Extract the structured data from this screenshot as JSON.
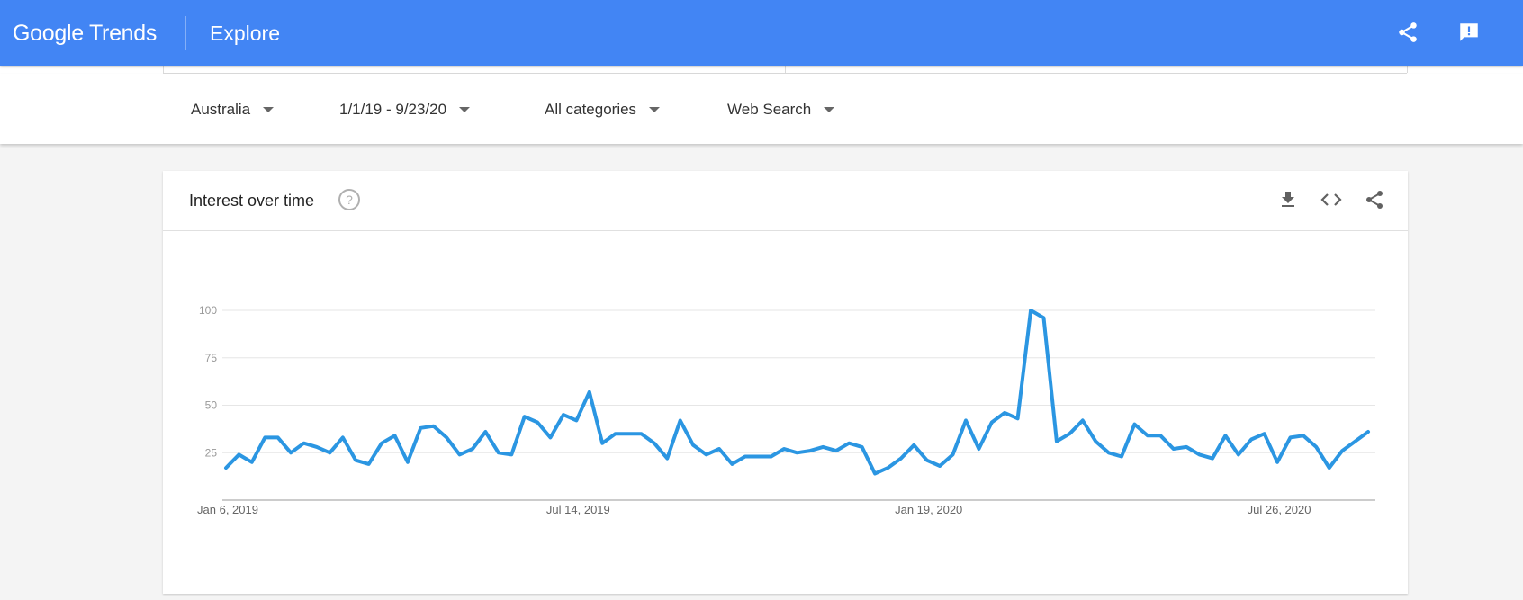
{
  "header": {
    "logo_text": "Google Trends",
    "page_title": "Explore",
    "share_icon": "share-icon",
    "feedback_icon": "feedback-icon"
  },
  "filters": {
    "region": "Australia",
    "date_range": "1/1/19 - 9/23/20",
    "category": "All categories",
    "search_type": "Web Search"
  },
  "card": {
    "title": "Interest over time",
    "help_icon": "help-icon",
    "actions": [
      "download-icon",
      "embed-icon",
      "share-icon"
    ]
  },
  "colors": {
    "appbar": "#4285f4",
    "series": "#2b96e2",
    "grid": "#e6e6e6",
    "axis": "#999999"
  },
  "chart_data": {
    "type": "line",
    "title": "",
    "xlabel": "",
    "ylabel": "",
    "ylim": [
      0,
      100
    ],
    "y_ticks": [
      25,
      50,
      75,
      100
    ],
    "x_tick_labels": [
      {
        "label": "Jan 6, 2019",
        "index": 0
      },
      {
        "label": "Jul 14, 2019",
        "index": 27
      },
      {
        "label": "Jan 19, 2020",
        "index": 54
      },
      {
        "label": "Jul 26, 2020",
        "index": 81
      }
    ],
    "grid": true,
    "x_start": "Jan 6, 2019",
    "x_interval": "week",
    "series": [
      {
        "values": [
          17,
          24,
          20,
          33,
          33,
          25,
          30,
          28,
          25,
          33,
          21,
          19,
          30,
          34,
          20,
          38,
          39,
          33,
          24,
          27,
          36,
          25,
          24,
          44,
          41,
          33,
          45,
          42,
          57,
          30,
          35,
          35,
          35,
          30,
          22,
          42,
          29,
          24,
          27,
          19,
          23,
          23,
          23,
          27,
          25,
          26,
          28,
          26,
          30,
          28,
          14,
          17,
          22,
          29,
          21,
          18,
          24,
          42,
          27,
          41,
          46,
          43,
          100,
          96,
          31,
          35,
          42,
          31,
          25,
          23,
          40,
          34,
          34,
          27,
          28,
          24,
          22,
          34,
          24,
          32,
          35,
          20,
          33,
          34,
          28,
          17,
          26,
          31,
          36
        ]
      }
    ]
  }
}
